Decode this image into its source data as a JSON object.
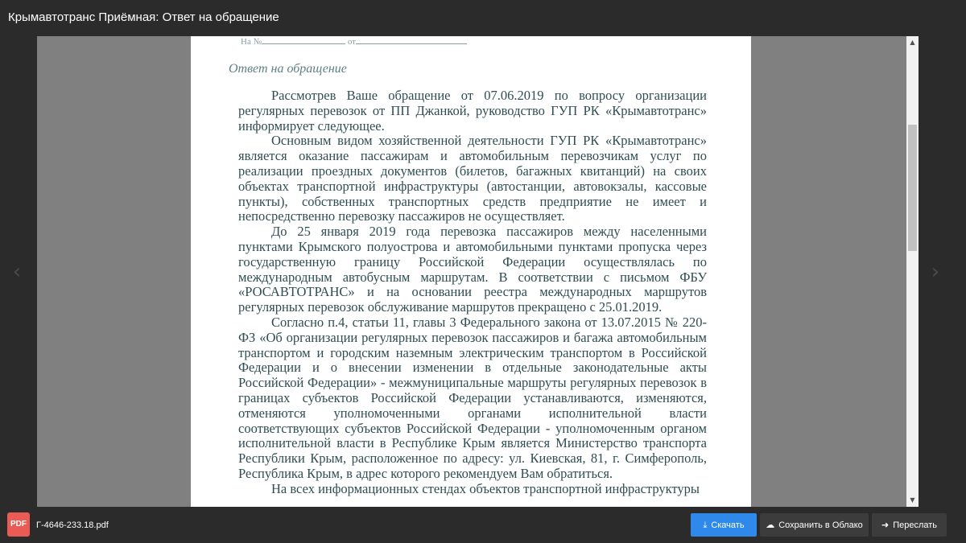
{
  "window": {
    "title": "Крымавтотранс Приёмная: Ответ на обращение"
  },
  "navigation": {
    "prev_icon": "chevron-left-icon",
    "next_icon": "chevron-right-icon",
    "prev_glyph": "‹",
    "next_glyph": "›"
  },
  "document": {
    "ref_line": {
      "number_label": "На №",
      "date_label": "от"
    },
    "heading": "Ответ на обращение",
    "paragraphs": [
      "Рассмотрев Ваше обращение от 07.06.2019 по вопросу организации регулярных перевозок от ПП Джанкой, руководство ГУП РК «Крымавтотранс» информирует следующее.",
      "Основным видом хозяйственной деятельности ГУП РК «Крымавтотранс» является оказание пассажирам и автомобильным перевозчикам услуг по реализации проездных документов (билетов, багажных квитанций) на своих объектах транспортной инфраструктуры (автостанции, автовокзалы, кассовые пункты), собственных транспортных средств предприятие не имеет и непосредственно перевозку пассажиров не осуществляет.",
      "До 25 января 2019 года перевозка пассажиров между населенными пунктами Крымского полуострова и автомобильными пунктами пропуска через государственную границу Российской Федерации осуществлялась по международным автобусным маршрутам. В соответствии с письмом ФБУ «РОСАВТОТРАНС» и на основании реестра международных маршрутов регулярных перевозок обслуживание маршрутов прекращено с 25.01.2019.",
      "Согласно п.4, статьи 11, главы 3 Федерального закона от 13.07.2015 № 220-ФЗ «Об организации регулярных перевозок пассажиров и багажа автомобильным транспортом и городским наземным электрическим транспортом в Российской Федерации и о внесении изменении в отдельные законодательные акты Российской Федерации» - межмуниципальные маршруты регулярных перевозок в границах субъектов Российской Федерации устанавливаются, изменяются, отменяются уполномоченными органами исполнительной власти соответствующих субъектов Российской Федерации - уполномоченным органом исполнительной власти в Республике Крым является Министерство транспорта Республики Крым, расположенное по адресу: ул. Киевская, 81, г. Симферополь, Республика Крым, в адрес которого рекомендуем Вам обратиться.",
      "На всех информационных стендах объектов транспортной инфраструктуры"
    ]
  },
  "scrollbar": {
    "up_icon": "scroll-up-arrow-icon",
    "down_icon": "scroll-down-arrow-icon",
    "up_glyph": "▲",
    "down_glyph": "▼"
  },
  "file": {
    "badge": "PDF",
    "name": "Г-4646-233.18.pdf"
  },
  "actions": {
    "download": {
      "label": "Скачать",
      "icon": "download-icon",
      "glyph": "⤓"
    },
    "save_cloud": {
      "label": "Сохранить в Облако",
      "icon": "cloud-upload-icon",
      "glyph": "☁"
    },
    "forward": {
      "label": "Переслать",
      "icon": "forward-arrow-icon",
      "glyph": "➜"
    }
  },
  "colors": {
    "chrome_background": "#2b2b2b",
    "viewer_background": "#808080",
    "page_background": "#ffffff",
    "document_text": "#2f4d52",
    "heading_text": "#5f7f82",
    "download_button": "#2e89ea",
    "secondary_button": "#3c3c3c",
    "pdf_badge": "#e95b54"
  }
}
